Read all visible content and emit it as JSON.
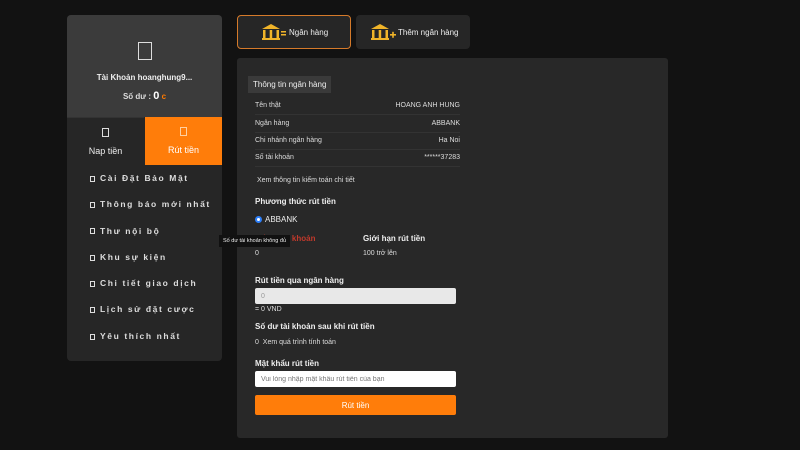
{
  "account": {
    "name": "Tài Khoản hoanghung9...",
    "balance_label": "Số dư :",
    "balance": "0",
    "currency": "c"
  },
  "tabs": {
    "deposit": "Nap tiền",
    "withdraw": "Rút tiền"
  },
  "menu": [
    "Cài Đặt Bảo Mật",
    "Thông báo mới nhất",
    "Thư nội bộ",
    "Khu sự kiện",
    "Chi tiết giao dịch",
    "Lịch sử đặt cược",
    "Yêu thích nhất"
  ],
  "top_tabs": {
    "bank": "Ngân hàng",
    "add_bank": "Thêm ngân hàng"
  },
  "bank_info": {
    "title": "Thông tin ngân hàng",
    "rows": [
      {
        "label": "Tên thật",
        "value": "HOANG ANH HUNG"
      },
      {
        "label": "Ngân hàng",
        "value": "ABBANK"
      },
      {
        "label": "Chi nhánh ngân hàng",
        "value": "Ha Noi"
      },
      {
        "label": "Số tài khoản",
        "value": "******37283"
      }
    ]
  },
  "audit_link": "Xem thông tin kiểm toán chi tiết",
  "method": {
    "title": "Phương thức rút tiền",
    "option": "ABBANK"
  },
  "balance_col": {
    "label": "Số dư tài khoản",
    "value": "0"
  },
  "limit_col": {
    "label": "Giới hạn rút tiền",
    "value": "100 trở lên"
  },
  "tooltip": "Số dư tài khoản không đủ",
  "withdraw": {
    "title": "Rút tiền qua ngân hàng",
    "value": "0",
    "converted": "= 0 VND"
  },
  "after": {
    "title": "Số dư tài khoản sau khi rút tiền",
    "value": "0",
    "link": "Xem quá trình tính toán"
  },
  "password": {
    "title": "Mật khẩu rút tiền",
    "placeholder": "Vui lòng nhập mật khẩu rút tiền của bạn"
  },
  "submit": "Rút tiền",
  "colors": {
    "accent": "#ff7d0a",
    "background": "#121212",
    "panel": "#282828",
    "error": "#c0392b"
  }
}
